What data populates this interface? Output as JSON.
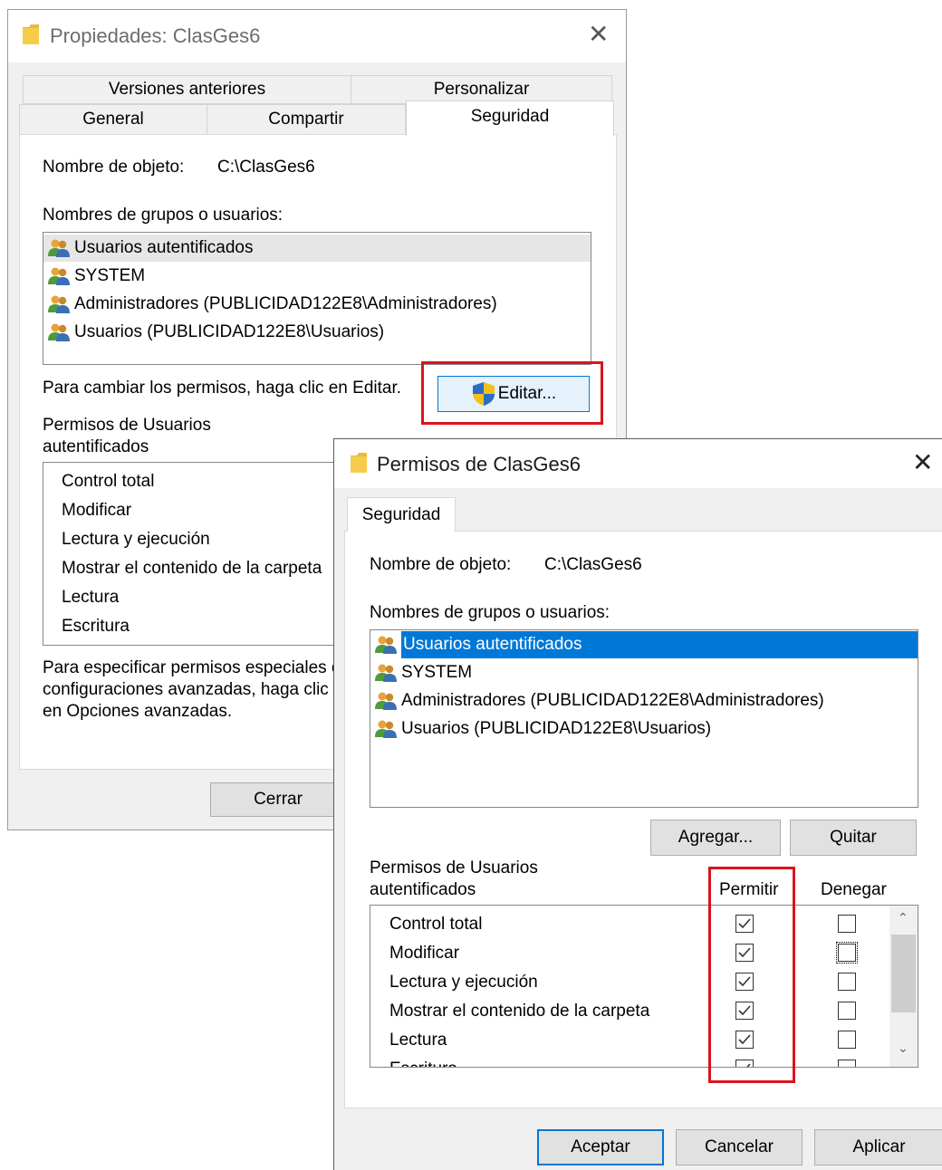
{
  "back_window": {
    "title": "Propiedades: ClasGes6",
    "tabs_row_top": [
      "Versiones anteriores",
      "Personalizar"
    ],
    "tabs_row_bottom": [
      "General",
      "Compartir",
      "Seguridad"
    ],
    "active_tab": "Seguridad",
    "object_name_label": "Nombre de objeto:",
    "object_name_value": "C:\\ClasGes6",
    "groups_label": "Nombres de grupos o usuarios:",
    "users": [
      "Usuarios autentificados",
      "SYSTEM",
      "Administradores (PUBLICIDAD122E8\\Administradores)",
      "Usuarios (PUBLICIDAD122E8\\Usuarios)"
    ],
    "change_hint": "Para cambiar los permisos, haga clic en Editar.",
    "edit_button": "Editar...",
    "perms_label_line1": "Permisos de Usuarios",
    "perms_label_line2": "autentificados",
    "permissions": [
      "Control total",
      "Modificar",
      "Lectura y ejecución",
      "Mostrar el contenido de la carpeta",
      "Lectura",
      "Escritura"
    ],
    "special_line1": "Para especificar permisos especiales o",
    "special_line2": "configuraciones avanzadas, haga clic",
    "special_line3": "en Opciones avanzadas.",
    "close_button": "Cerrar"
  },
  "front_window": {
    "title": "Permisos de ClasGes6",
    "tab": "Seguridad",
    "object_name_label": "Nombre de objeto:",
    "object_name_value": "C:\\ClasGes6",
    "groups_label": "Nombres de grupos o usuarios:",
    "users": [
      "Usuarios autentificados",
      "SYSTEM",
      "Administradores (PUBLICIDAD122E8\\Administradores)",
      "Usuarios (PUBLICIDAD122E8\\Usuarios)"
    ],
    "add_button": "Agregar...",
    "remove_button": "Quitar",
    "perms_label_line1": "Permisos de Usuarios",
    "perms_label_line2": "autentificados",
    "allow_header": "Permitir",
    "deny_header": "Denegar",
    "permissions": [
      {
        "name": "Control total",
        "allow": true,
        "deny": false
      },
      {
        "name": "Modificar",
        "allow": true,
        "deny": false
      },
      {
        "name": "Lectura y ejecución",
        "allow": true,
        "deny": false
      },
      {
        "name": "Mostrar el contenido de la carpeta",
        "allow": true,
        "deny": false
      },
      {
        "name": "Lectura",
        "allow": true,
        "deny": false
      },
      {
        "name": "Escritura",
        "allow": true,
        "deny": false
      }
    ],
    "ok_button": "Aceptar",
    "cancel_button": "Cancelar",
    "apply_button": "Aplicar"
  },
  "colors": {
    "selection": "#0078d7",
    "highlight_annotation": "#d9141c",
    "window_bg": "#f0f0f0"
  }
}
